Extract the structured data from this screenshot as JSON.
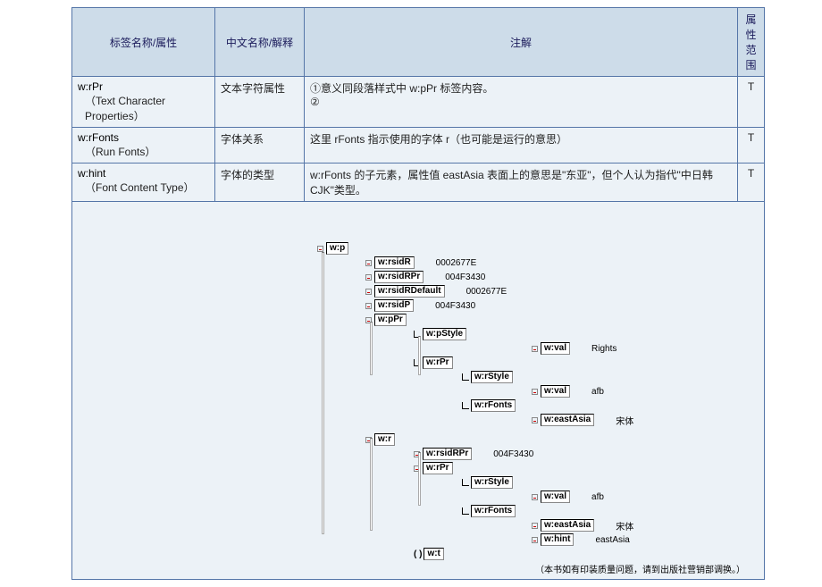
{
  "headers": {
    "tag": "标签名称/属性",
    "cn": "中文名称/解释",
    "annot": "注解",
    "range": "属性范围"
  },
  "rows": [
    {
      "tag_main": "w:rPr",
      "tag_sub": "（Text Character Properties）",
      "cn": "文本字符属性",
      "annot_l1": "①意义同段落样式中 w:pPr 标签内容。",
      "annot_l2": "②",
      "range": "T"
    },
    {
      "tag_main": "w:rFonts",
      "tag_sub": "（Run Fonts）",
      "cn": "字体关系",
      "annot_l1": "这里 rFonts 指示使用的字体 r（也可能是运行的意思）",
      "annot_l2": "",
      "range": "T"
    },
    {
      "tag_main": "w:hint",
      "tag_sub": "（Font Content Type）",
      "cn": "字体的类型",
      "annot_l1": "w:rFonts 的子元素，属性值 eastAsia 表面上的意思是\"东亚\"，但个人认为指代\"中日韩 CJK\"类型。",
      "annot_l2": "",
      "range": "T"
    }
  ],
  "tree": {
    "n_wp": "w:p",
    "n_rsidR": "w:rsidR",
    "v_rsidR": "0002677E",
    "n_rsidRPr": "w:rsidRPr",
    "v_rsidRPr": "004F3430",
    "n_rsidRDef": "w:rsidRDefault",
    "v_rsidRDef": "0002677E",
    "n_rsidP": "w:rsidP",
    "v_rsidP": "004F3430",
    "n_pPr": "w:pPr",
    "n_pStyle": "w:pStyle",
    "n_val": "w:val",
    "v_pStyleVal": "Rights",
    "n_rPr": "w:rPr",
    "n_rStyle": "w:rStyle",
    "v_rStyleVal": "afb",
    "n_rFonts": "w:rFonts",
    "n_eastAsia": "w:eastAsia",
    "v_eastAsia": "宋体",
    "n_wr": "w:r",
    "v_rsidRPr2": "004F3430",
    "v_rStyleVal2": "afb",
    "v_eastAsia2": "宋体",
    "n_hint": "w:hint",
    "v_hint": "eastAsia",
    "n_wt": "w:t",
    "footnote": "（本书如有印装质量问题，请到出版社营销部调换。）"
  }
}
